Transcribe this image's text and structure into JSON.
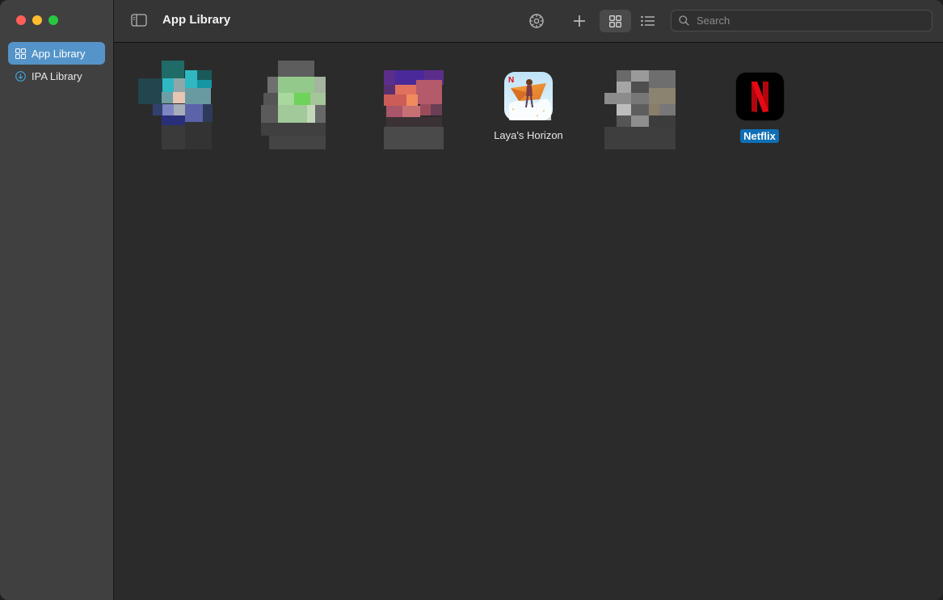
{
  "window": {
    "title": "App Library"
  },
  "sidebar": {
    "items": [
      {
        "label": "App Library",
        "icon": "grid-icon",
        "active": true
      },
      {
        "label": "IPA Library",
        "icon": "download-circle-icon",
        "active": false
      }
    ]
  },
  "toolbar": {
    "title": "App Library",
    "search": {
      "placeholder": "Search",
      "value": ""
    },
    "view_mode": "grid"
  },
  "apps": [
    {
      "label": "",
      "icon": "obscured-app-icon",
      "selected": false
    },
    {
      "label": "",
      "icon": "obscured-app-icon",
      "selected": false
    },
    {
      "label": "",
      "icon": "obscured-app-icon",
      "selected": false
    },
    {
      "label": "Laya's Horizon",
      "icon": "layas-horizon-icon",
      "selected": false
    },
    {
      "label": "",
      "icon": "obscured-app-icon",
      "selected": false
    },
    {
      "label": "Netflix",
      "icon": "netflix-icon",
      "selected": true
    }
  ],
  "colors": {
    "accent": "#5494c9",
    "selection": "#0f6fb6",
    "netflix_red": "#e50914"
  }
}
